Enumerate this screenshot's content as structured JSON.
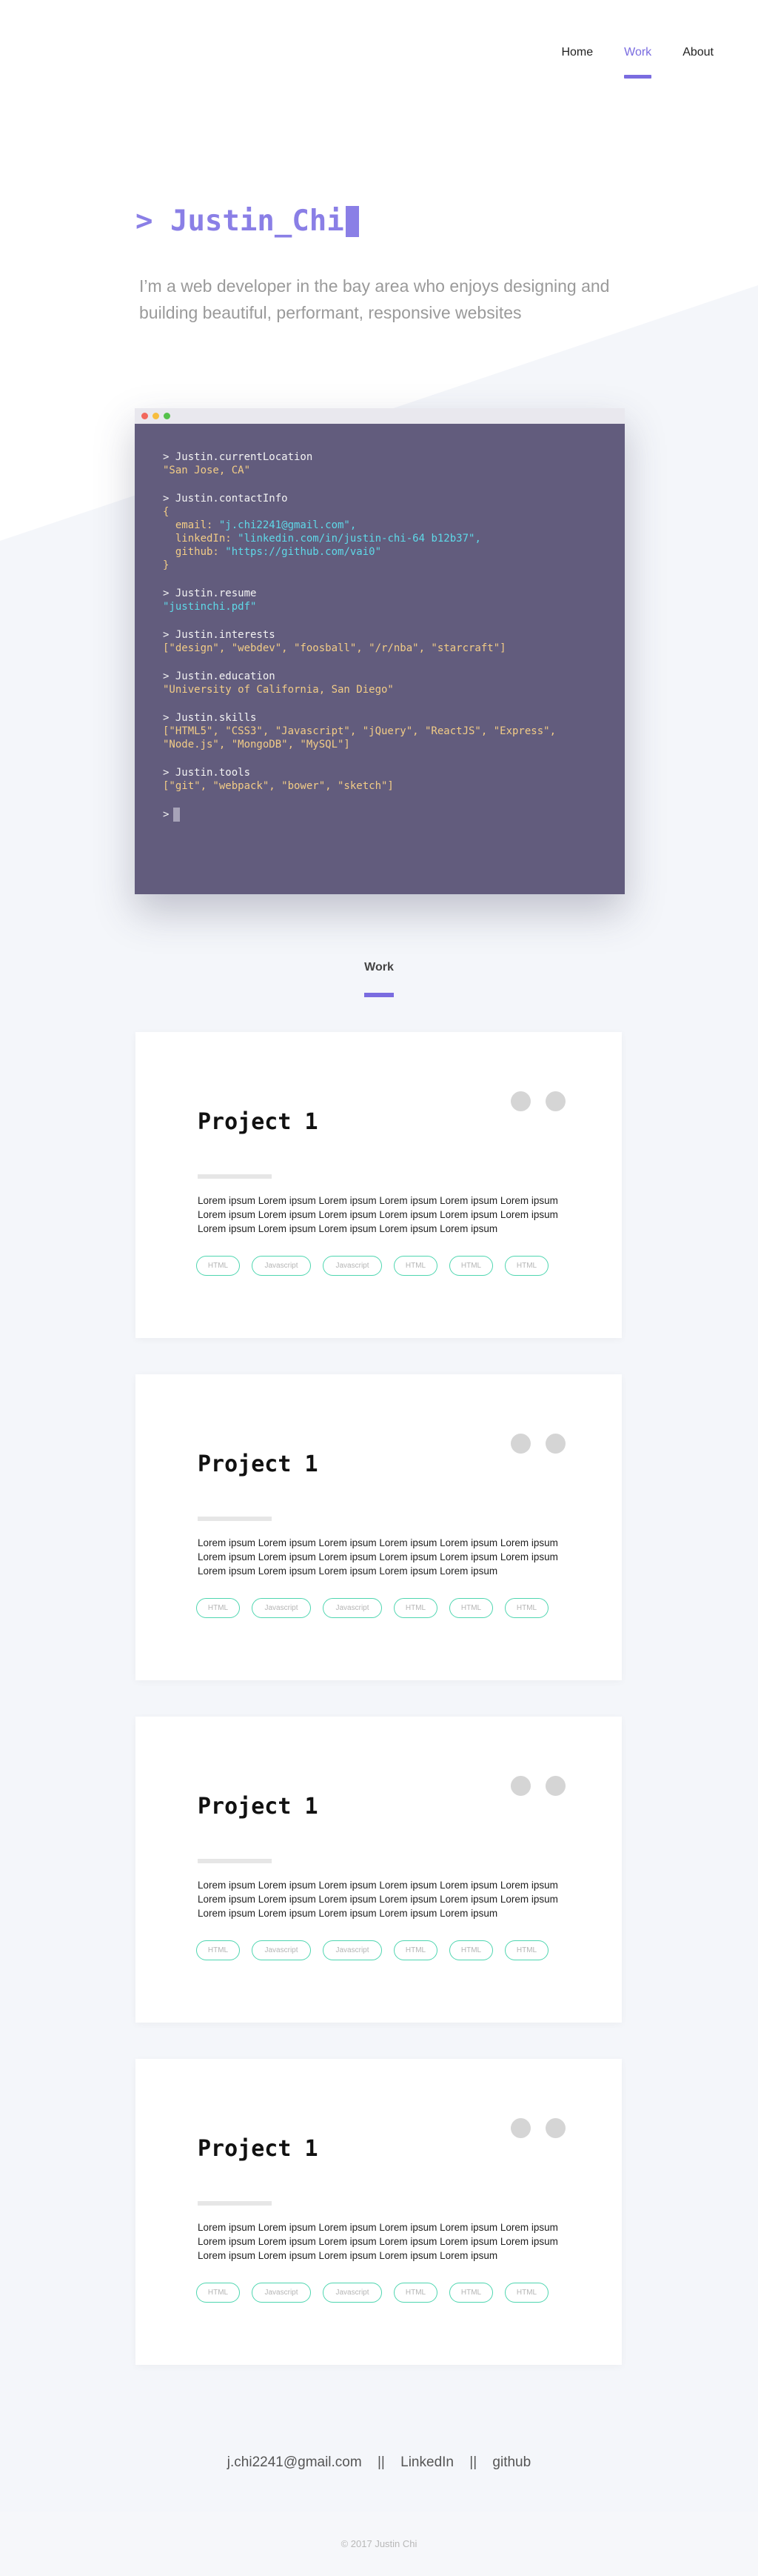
{
  "nav": {
    "items": [
      {
        "label": "Home"
      },
      {
        "label": "Work"
      },
      {
        "label": "About"
      }
    ]
  },
  "hero": {
    "title": "> Justin_Chi",
    "description": "I’m a web developer in the bay area who enjoys designing and building beautiful, performant, responsive websites"
  },
  "terminal": {
    "lines": {
      "loc_cmd": "> Justin.currentLocation",
      "loc_val": "\"San Jose, CA\"",
      "contact_cmd": "> Justin.contactInfo",
      "brace_open": "{",
      "email_key": "  email: ",
      "email_val": "\"j.chi2241@gmail.com\",",
      "linkedin_key": "  linkedIn: ",
      "linkedin_val": "\"linkedin.com/in/justin-chi-64 b12b37\",",
      "github_key": "  github: ",
      "github_val": "\"https://github.com/vai0\"",
      "brace_close": "}",
      "resume_cmd": "> Justin.resume",
      "resume_val": "\"justinchi.pdf\"",
      "interests_cmd": "> Justin.interests",
      "interests_val": "[\"design\", \"webdev\", \"foosball\", \"/r/nba\", \"starcraft\"]",
      "edu_cmd": "> Justin.education",
      "edu_val": "\"University of California, San Diego\"",
      "skills_cmd": "> Justin.skills",
      "skills_val1": "[\"HTML5\", \"CSS3\", \"Javascript\", \"jQuery\", \"ReactJS\", \"Express\",",
      "skills_val2": "\"Node.js\", \"MongoDB\", \"MySQL\"]",
      "tools_cmd": "> Justin.tools",
      "tools_val": "[\"git\", \"webpack\", \"bower\", \"sketch\"]",
      "prompt": ">"
    },
    "colors": {
      "body": "#625c7d",
      "string": "#f2cc86",
      "link": "#5ed9e8",
      "dot_red": "#f2675d",
      "dot_yellow": "#f7bd3e",
      "dot_green": "#55c14b"
    }
  },
  "work": {
    "heading": "Work",
    "projects": [
      {
        "title": "Project 1",
        "description": "Lorem ipsum Lorem ipsum Lorem ipsum Lorem ipsum Lorem ipsum Lorem ipsum Lorem ipsum Lorem ipsum Lorem ipsum Lorem ipsum Lorem ipsum Lorem ipsum Lorem ipsum Lorem ipsum Lorem ipsum Lorem ipsum Lorem ipsum",
        "tags": [
          "HTML",
          "Javascript",
          "Javascript",
          "HTML",
          "HTML",
          "HTML"
        ]
      },
      {
        "title": "Project 1",
        "description": "Lorem ipsum Lorem ipsum Lorem ipsum Lorem ipsum Lorem ipsum Lorem ipsum Lorem ipsum Lorem ipsum Lorem ipsum Lorem ipsum Lorem ipsum Lorem ipsum Lorem ipsum Lorem ipsum Lorem ipsum Lorem ipsum Lorem ipsum",
        "tags": [
          "HTML",
          "Javascript",
          "Javascript",
          "HTML",
          "HTML",
          "HTML"
        ]
      },
      {
        "title": "Project 1",
        "description": "Lorem ipsum Lorem ipsum Lorem ipsum Lorem ipsum Lorem ipsum Lorem ipsum Lorem ipsum Lorem ipsum Lorem ipsum Lorem ipsum Lorem ipsum Lorem ipsum Lorem ipsum Lorem ipsum Lorem ipsum Lorem ipsum Lorem ipsum",
        "tags": [
          "HTML",
          "Javascript",
          "Javascript",
          "HTML",
          "HTML",
          "HTML"
        ]
      },
      {
        "title": "Project 1",
        "description": "Lorem ipsum Lorem ipsum Lorem ipsum Lorem ipsum Lorem ipsum Lorem ipsum Lorem ipsum Lorem ipsum Lorem ipsum Lorem ipsum Lorem ipsum Lorem ipsum Lorem ipsum Lorem ipsum Lorem ipsum Lorem ipsum Lorem ipsum",
        "tags": [
          "HTML",
          "Javascript",
          "Javascript",
          "HTML",
          "HTML",
          "HTML"
        ]
      }
    ]
  },
  "footer": {
    "email": "j.chi2241@gmail.com",
    "sep1": "||",
    "linkedin": "LinkedIn",
    "sep2": "||",
    "github": "github",
    "copyright": "© 2017 Justin Chi"
  },
  "theme": {
    "accent": "#7a6ce0",
    "tag_border": "#4fd6b0",
    "page_tint": "#f4f6fa"
  }
}
